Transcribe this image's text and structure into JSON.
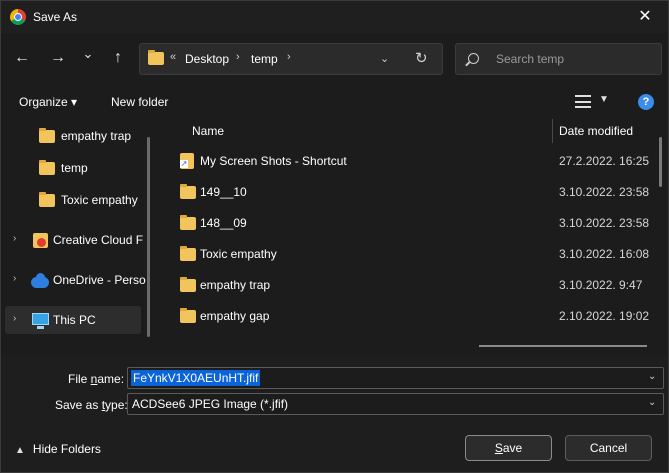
{
  "window": {
    "title": "Save As"
  },
  "nav": {
    "back": "←",
    "forward": "→",
    "recent": "⌄",
    "up": "↑",
    "path": [
      "Desktop",
      "temp"
    ],
    "path_prefix": "«",
    "sep": "›",
    "dropdown": "⌄",
    "refresh": "↻",
    "search_placeholder": "Search temp"
  },
  "commands": {
    "organize": "Organize ▾",
    "new_folder": "New folder",
    "help": "?"
  },
  "sidebar": {
    "items": [
      {
        "label": "empathy trap",
        "icon": "folder-icon"
      },
      {
        "label": "temp",
        "icon": "folder-icon"
      },
      {
        "label": "Toxic empathy",
        "icon": "folder-icon"
      },
      {
        "label": "Creative Cloud F",
        "icon": "creative-cloud-icon"
      },
      {
        "label": "OneDrive - Perso",
        "icon": "onedrive-cloud-icon"
      },
      {
        "label": "This PC",
        "icon": "this-pc-icon"
      }
    ]
  },
  "list": {
    "columns": {
      "name": "Name",
      "date": "Date modified"
    },
    "rows": [
      {
        "name": "My Screen Shots - Shortcut",
        "date": "27.2.2022. 16:25",
        "icon": "shortcut-icon"
      },
      {
        "name": "149__10",
        "date": "3.10.2022. 23:58",
        "icon": "folder-icon"
      },
      {
        "name": "148__09",
        "date": "3.10.2022. 23:58",
        "icon": "folder-icon"
      },
      {
        "name": "Toxic empathy",
        "date": "3.10.2022. 16:08",
        "icon": "folder-icon"
      },
      {
        "name": "empathy trap",
        "date": "3.10.2022. 9:47",
        "icon": "folder-icon"
      },
      {
        "name": "empathy gap",
        "date": "2.10.2022. 19:02",
        "icon": "folder-icon"
      }
    ]
  },
  "form": {
    "file_name_label_pre": "File ",
    "file_name_label_u": "n",
    "file_name_label_post": "ame:",
    "file_name_value": "FeYnkV1X0AEUnHT.jfif",
    "save_type_label_pre": "Save as ",
    "save_type_label_u": "t",
    "save_type_label_post": "ype:",
    "save_type_value": "ACDSee6 JPEG Image (*.jfif)"
  },
  "footer": {
    "hide_folders": "Hide Folders",
    "save_pre": "",
    "save_u": "S",
    "save_post": "ave",
    "cancel": "Cancel"
  }
}
